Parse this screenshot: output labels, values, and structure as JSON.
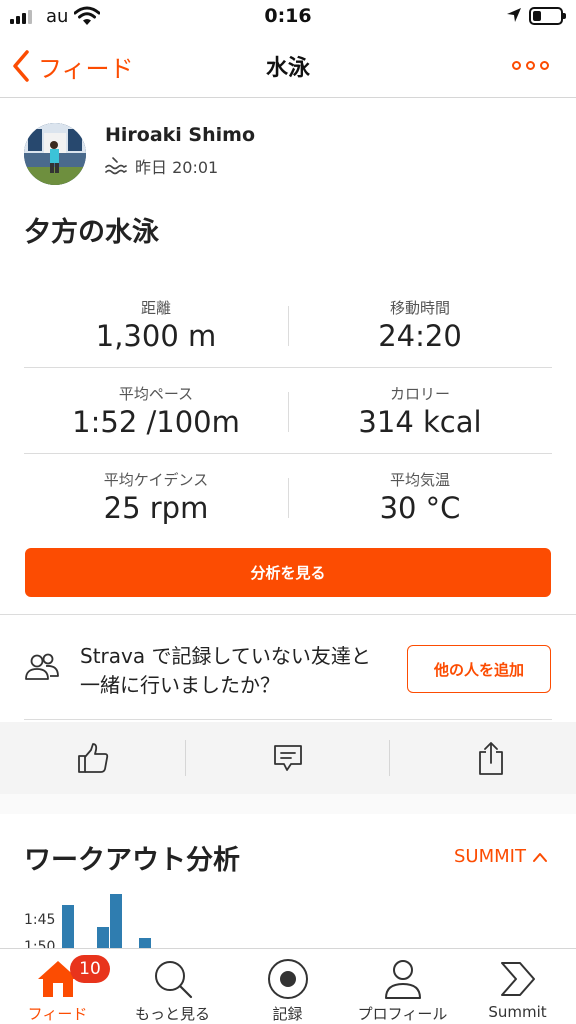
{
  "status_bar": {
    "carrier": "au",
    "time": "0:16",
    "battery_level": 0.3
  },
  "nav": {
    "back_label": "フィード",
    "title": "水泳"
  },
  "activity": {
    "athlete_name": "Hiroaki Shimo",
    "sport_icon": "swim-icon",
    "timestamp": "昨日 20:01",
    "title": "夕方の水泳"
  },
  "stats": [
    {
      "label": "距離",
      "value": "1,300 m"
    },
    {
      "label": "移動時間",
      "value": "24:20"
    },
    {
      "label": "平均ペース",
      "value": "1:52 /100m"
    },
    {
      "label": "カロリー",
      "value": "314 kcal"
    },
    {
      "label": "平均ケイデンス",
      "value": "25 rpm"
    },
    {
      "label": "平均気温",
      "value": "30 °C"
    }
  ],
  "analysis_button": "分析を見る",
  "friends_prompt": {
    "text": "Strava で記録していない友達と一緒に行いましたか？",
    "button": "他の人を追加"
  },
  "actions": [
    {
      "icon": "thumbs-up-icon"
    },
    {
      "icon": "comment-icon"
    },
    {
      "icon": "share-icon"
    }
  ],
  "workout": {
    "title": "ワークアウト分析",
    "summit_link": "SUMMIT",
    "ticks": [
      "1:45",
      "1:50"
    ]
  },
  "tabs": [
    {
      "label": "フィード",
      "icon": "home-icon",
      "badge": "10",
      "active": true
    },
    {
      "label": "もっと見る",
      "icon": "search-icon"
    },
    {
      "label": "記録",
      "icon": "record-icon"
    },
    {
      "label": "プロフィール",
      "icon": "profile-icon"
    },
    {
      "label": "Summit",
      "icon": "summit-icon"
    }
  ],
  "colors": {
    "accent": "#fc4c02",
    "badge": "#e8341c",
    "chart_bar": "#2f7db0"
  }
}
